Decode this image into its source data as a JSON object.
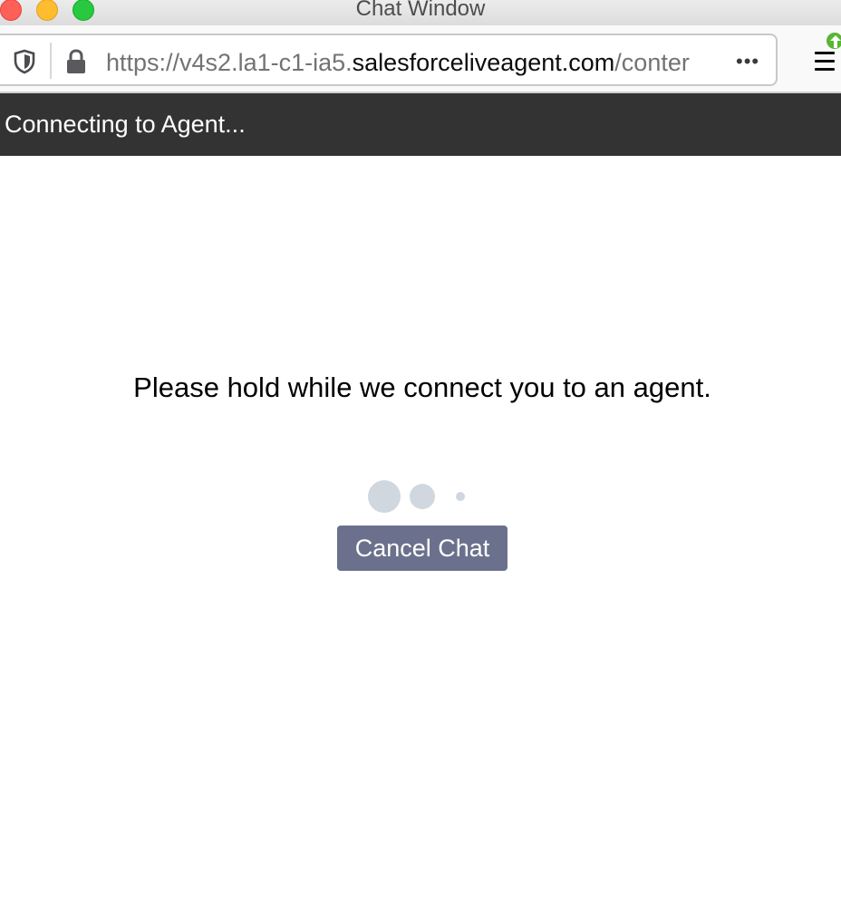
{
  "window": {
    "title": "Chat Window",
    "traffic_lights": [
      "close",
      "minimize",
      "zoom"
    ]
  },
  "browser": {
    "url_prefix": "https://v4s2.la1-c1-ia5.",
    "url_domain": "salesforceliveagent.com",
    "url_suffix": "/conter",
    "more_label": "•••",
    "icons": [
      "shield-icon",
      "lock-icon",
      "more-icon",
      "menu-icon",
      "update-arrow-icon"
    ],
    "accent_update_color": "#58b633"
  },
  "chat": {
    "header_title": "Connecting to Agent...",
    "waiting_message": "Please hold while we connect you to an agent.",
    "cancel_label": "Cancel Chat",
    "header_color": "#333333",
    "button_color": "#6b718c"
  }
}
